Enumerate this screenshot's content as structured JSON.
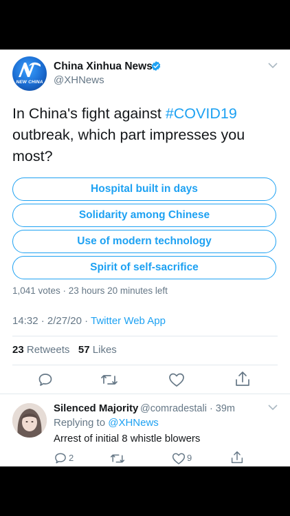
{
  "tweet": {
    "author_name": "China Xinhua News",
    "author_handle": "@XHNews",
    "avatar_text": "NEW CHINA",
    "text_before": "In China's fight against ",
    "hashtag": "#COVID19",
    "text_after": " outbreak, which part impresses you most?",
    "poll_options": [
      "Hospital built in days",
      "Solidarity among Chinese",
      "Use of modern technology",
      "Spirit of self-sacrifice"
    ],
    "poll_info": "1,041 votes · 23 hours 20 minutes left",
    "time": "14:32 · 2/27/20 · ",
    "source": "Twitter Web App",
    "retweets_count": "23",
    "retweets_label": "Retweets",
    "likes_count": "57",
    "likes_label": "Likes"
  },
  "reply": {
    "author_name": "Silenced Majority",
    "author_handle": "@comradestali · 39m",
    "replying_prefix": "Replying to ",
    "replying_handle": "@XHNews",
    "text": "Arrest of initial 8 whistle blowers",
    "reply_count": "2",
    "like_count": "9"
  },
  "colors": {
    "accent": "#1da1f2",
    "secondary_text": "#657786",
    "divider": "#e1e8ed"
  },
  "icons": [
    "verified-badge-icon",
    "chevron-down-icon",
    "reply-icon",
    "retweet-icon",
    "like-icon",
    "share-icon"
  ]
}
